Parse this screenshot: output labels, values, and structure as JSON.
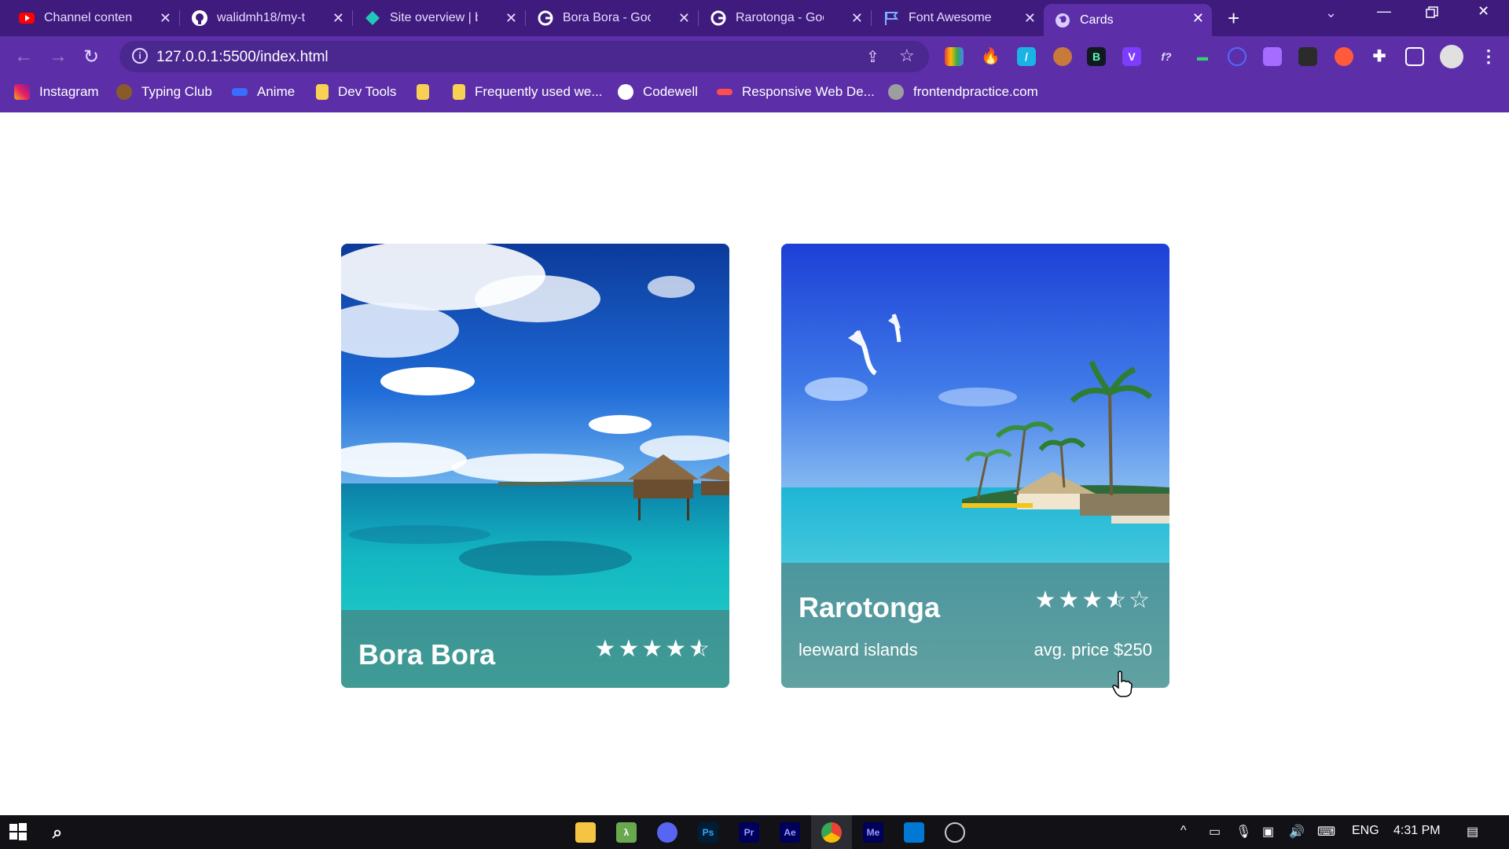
{
  "browser": {
    "tabs": [
      {
        "title": "Channel content",
        "favicon": "youtube-icon"
      },
      {
        "title": "walidmh18/my-t",
        "favicon": "github-icon"
      },
      {
        "title": "Site overview | be",
        "favicon": "netlify-icon"
      },
      {
        "title": "Bora Bora - Goog",
        "favicon": "google-icon"
      },
      {
        "title": "Rarotonga - Goo",
        "favicon": "google-icon"
      },
      {
        "title": "Font Awesome",
        "favicon": "font-awesome-flag-icon"
      },
      {
        "title": "Cards",
        "favicon": "globe-icon",
        "active": true
      }
    ],
    "url": "127.0.0.1:5500/index.html",
    "bookmarks": [
      {
        "label": "Instagram"
      },
      {
        "label": "Typing Club"
      },
      {
        "label": "Anime"
      },
      {
        "label": "Dev Tools"
      },
      {
        "label": ""
      },
      {
        "label": "Frequently used we..."
      },
      {
        "label": "Codewell"
      },
      {
        "label": "Responsive Web De..."
      },
      {
        "label": "frontendpractice.com"
      }
    ],
    "colors": {
      "frame": "#5c2fa8",
      "tabstrip": "#3e1b7d"
    }
  },
  "cards": [
    {
      "title": "Bora Bora",
      "rating": 4.5,
      "stars": [
        "full",
        "full",
        "full",
        "full",
        "half"
      ],
      "location": "",
      "price": ""
    },
    {
      "title": "Rarotonga",
      "rating": 3.5,
      "stars": [
        "full",
        "full",
        "full",
        "half",
        "empty"
      ],
      "location": "leeward islands",
      "price": "avg. price $250"
    }
  ],
  "taskbar": {
    "apps": [
      "file-explorer-icon",
      "lambda-icon",
      "discord-icon",
      "Ps",
      "Pr",
      "Ae",
      "chrome-icon",
      "Me",
      "vscode-icon",
      "obs-icon"
    ],
    "language": "ENG",
    "time": "4:31 PM"
  }
}
